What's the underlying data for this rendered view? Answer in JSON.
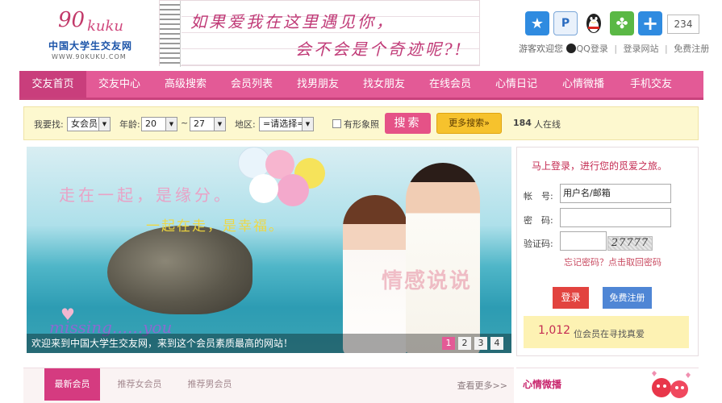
{
  "logo": {
    "number": "90",
    "script": "kuku",
    "name": "中国大学生交友网",
    "url": "WWW.90KUKU.COM"
  },
  "banner": {
    "line1": "如果爱我在这里遇见你，",
    "line2": "会不会是个奇迹呢?!"
  },
  "header": {
    "counter": "234",
    "welcome": "游客欢迎您",
    "qq_login": "QQ登录",
    "site_login": "登录网站",
    "free_register": "免费注册",
    "icons": [
      "star-icon",
      "search-icon",
      "qq-penguin-icon",
      "clover-icon",
      "plus-icon"
    ]
  },
  "nav": {
    "items": [
      "交友首页",
      "交友中心",
      "高级搜索",
      "会员列表",
      "找男朋友",
      "找女朋友",
      "在线会员",
      "心情日记",
      "心情微播",
      "手机交友"
    ],
    "active_index": 0
  },
  "search": {
    "find_label": "我要找:",
    "gender_value": "女会员",
    "age_label": "年龄:",
    "age_from": "20",
    "age_sep": "~",
    "age_to": "27",
    "region_label": "地区:",
    "region_value": "=请选择=",
    "photo_label": "有形象照",
    "search_button": "搜索",
    "more_button": "更多搜索»",
    "online_count": "184",
    "online_label": "人在线"
  },
  "hero": {
    "text1": "走在一起，是缘分。",
    "text2": "一起在走，是幸福。",
    "watermark": "情感说说",
    "missing": "missing......you",
    "caption": "欢迎来到中国大学生交友网，来到这个会员素质最高的网站！",
    "pages": [
      "1",
      "2",
      "3",
      "4"
    ],
    "active_page": 0
  },
  "login": {
    "title": "马上登录，进行您的觅爱之旅。",
    "account_label": "帐　号:",
    "account_value": "用户名/邮箱",
    "password_label": "密　码:",
    "captcha_label": "验证码:",
    "captcha_text": "27777",
    "forgot": "忘记密码？点击取回密码",
    "login_button": "登录",
    "register_button": "免费注册",
    "member_count": "1,012",
    "member_text": "位会员在寻找真爱"
  },
  "tabs": {
    "items": [
      "最新会员",
      "推荐女会员",
      "推荐男会员"
    ],
    "active_index": 0,
    "more": "查看更多>>"
  },
  "mood": {
    "title": "心情微播"
  },
  "colors": {
    "brand_pink": "#e35a96",
    "nav_active": "#c93e7c",
    "accent_red": "#c42b52",
    "yellow_bar": "#fdf8cf"
  }
}
